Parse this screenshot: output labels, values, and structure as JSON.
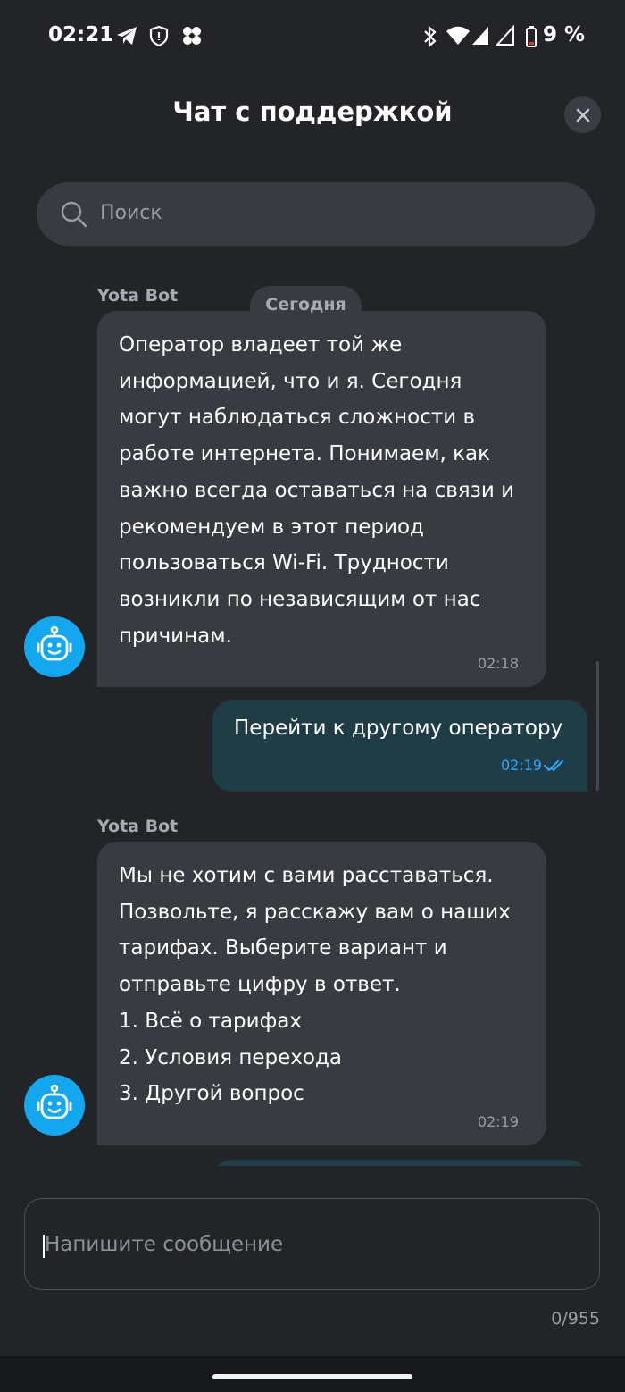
{
  "status_bar": {
    "time": "02:21",
    "battery": "9 %"
  },
  "header": {
    "title": "Чат с поддержкой"
  },
  "search": {
    "placeholder": "Поиск"
  },
  "chat": {
    "date_separator": "Сегодня",
    "messages": [
      {
        "sender": "Yota Bot",
        "lines": [
          "Оператор владеет той же",
          "информацией, что и я. Сегодня",
          "могут наблюдаться сложности в",
          "работе интернета. Понимаем, как",
          "важно всегда оставаться на связи и",
          "рекомендуем в этот период",
          "пользоваться Wi-Fi. Трудности",
          "возникли по независящим от нас",
          "причинам."
        ],
        "time": "02:18"
      },
      {
        "text": "Перейти к другому оператору",
        "time": "02:19"
      },
      {
        "sender": "Yota Bot",
        "lines": [
          "Мы не хотим с вами расставаться.",
          "Позвольте, я расскажу вам о наших",
          "тарифах. Выберите вариант и",
          "отправьте цифру в ответ.",
          "1. Всё о тарифах",
          "2. Условия перехода",
          "3. Другой вопрос"
        ],
        "time": "02:19"
      }
    ]
  },
  "composer": {
    "placeholder": "Напишите сообщение",
    "counter": "0/955"
  },
  "colors": {
    "background": "#232428",
    "bubble_in": "#393b42",
    "bubble_out": "#1f3d47",
    "accent": "#12a7ef",
    "read_check": "#2fa6ff"
  },
  "icons": [
    "telegram-icon",
    "shield-icon",
    "app-icon",
    "bluetooth-icon",
    "wifi-icon",
    "signal-icon",
    "battery-icon",
    "close-icon",
    "search-icon",
    "bot-avatar-icon",
    "double-check-icon"
  ]
}
